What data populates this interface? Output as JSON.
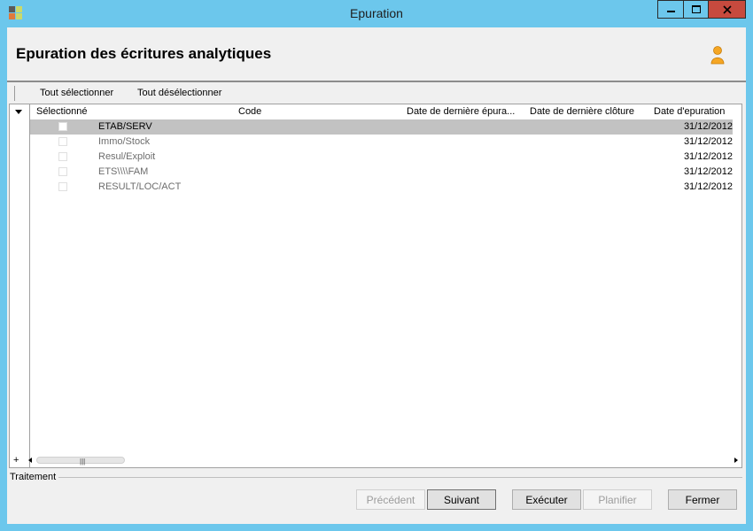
{
  "window": {
    "title": "Epuration",
    "controls": {
      "minimize": "▁",
      "maximize": "□",
      "close": "✕"
    },
    "colors": {
      "frame": "#6cc7ec",
      "close": "#c74a3e"
    }
  },
  "header": {
    "title": "Epuration des écritures analytiques",
    "icon": "user-icon"
  },
  "toolbar": {
    "select_all": "Tout sélectionner",
    "deselect_all": "Tout désélectionner"
  },
  "grid": {
    "columns": {
      "selected": "Sélectionné",
      "code": "Code",
      "last_purge": "Date de dernière épura...",
      "last_close": "Date de dernière clôture",
      "purge_date": "Date d'epuration"
    },
    "rows": [
      {
        "code": "ETAB/SERV",
        "purge_date": "31/12/2012",
        "checked": false
      },
      {
        "code": "Immo/Stock",
        "purge_date": "31/12/2012",
        "checked": false
      },
      {
        "code": "Resul/Exploit",
        "purge_date": "31/12/2012",
        "checked": false
      },
      {
        "code": "ETS\\\\\\\\FAM",
        "purge_date": "31/12/2012",
        "checked": false
      },
      {
        "code": "RESULT/LOC/ACT",
        "purge_date": "31/12/2012",
        "checked": false
      }
    ],
    "footer": {
      "add": "+"
    }
  },
  "section": {
    "label": "Traitement"
  },
  "buttons": {
    "previous": "Précédent",
    "next": "Suivant",
    "execute": "Exécuter",
    "schedule": "Planifier",
    "close": "Fermer"
  }
}
